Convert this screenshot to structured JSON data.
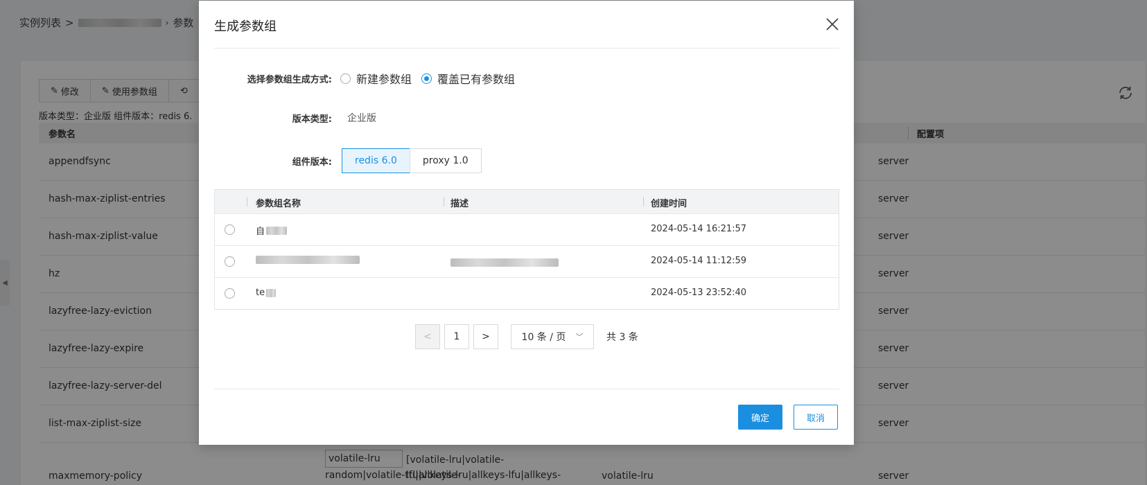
{
  "background": {
    "breadcrumb": {
      "root": "实例列表",
      "separator": ">",
      "current": "参数"
    },
    "toolbar": {
      "edit_label": "修改",
      "use_group_label": "使用参数组"
    },
    "version_info": "版本类型：企业版    组件版本：redis 6.",
    "table": {
      "headers": {
        "param_name": "参数名",
        "config_item": "配置项"
      },
      "rows": [
        {
          "name": "appendfsync",
          "config": "server"
        },
        {
          "name": "hash-max-ziplist-entries",
          "config": "server"
        },
        {
          "name": "hash-max-ziplist-value",
          "config": "server"
        },
        {
          "name": "hz",
          "config": "server"
        },
        {
          "name": "lazyfree-lazy-eviction",
          "config": "server"
        },
        {
          "name": "lazyfree-lazy-expire",
          "config": "server"
        },
        {
          "name": "lazyfree-lazy-server-del",
          "config": "server"
        },
        {
          "name": "list-max-ziplist-size",
          "config": "server"
        }
      ],
      "last_row": {
        "name": "maxmemory-policy",
        "value": "volatile-lru",
        "range_line1": "[volatile-lru|volatile-lfu|volatile-",
        "range_line2": "random|volatile-ttl|allkeys-lru|allkeys-lfu|allkeys-",
        "default": "volatile-lru",
        "config": "server"
      }
    }
  },
  "modal": {
    "title": "生成参数组",
    "mode": {
      "label": "选择参数组生成方式:",
      "options": [
        {
          "label": "新建参数组",
          "checked": false
        },
        {
          "label": "覆盖已有参数组",
          "checked": true
        }
      ]
    },
    "version_type": {
      "label": "版本类型:",
      "value": "企业版"
    },
    "component_version": {
      "label": "组件版本:",
      "options": [
        {
          "label": "redis 6.0",
          "active": true
        },
        {
          "label": "proxy 1.0",
          "active": false
        }
      ]
    },
    "group_table": {
      "headers": {
        "name": "参数组名称",
        "description": "描述",
        "created": "创建时间"
      },
      "rows": [
        {
          "name": "自",
          "description": "",
          "created": "2024-05-14 16:21:57"
        },
        {
          "name": "",
          "description": "",
          "created": "2024-05-14 11:12:59"
        },
        {
          "name": "te",
          "description": "",
          "created": "2024-05-13 23:52:40"
        }
      ]
    },
    "pagination": {
      "prev": "<",
      "page": "1",
      "next": ">",
      "page_size": "10 条 / 页",
      "total": "共 3 条"
    },
    "footer": {
      "confirm": "确定",
      "cancel": "取消"
    }
  }
}
